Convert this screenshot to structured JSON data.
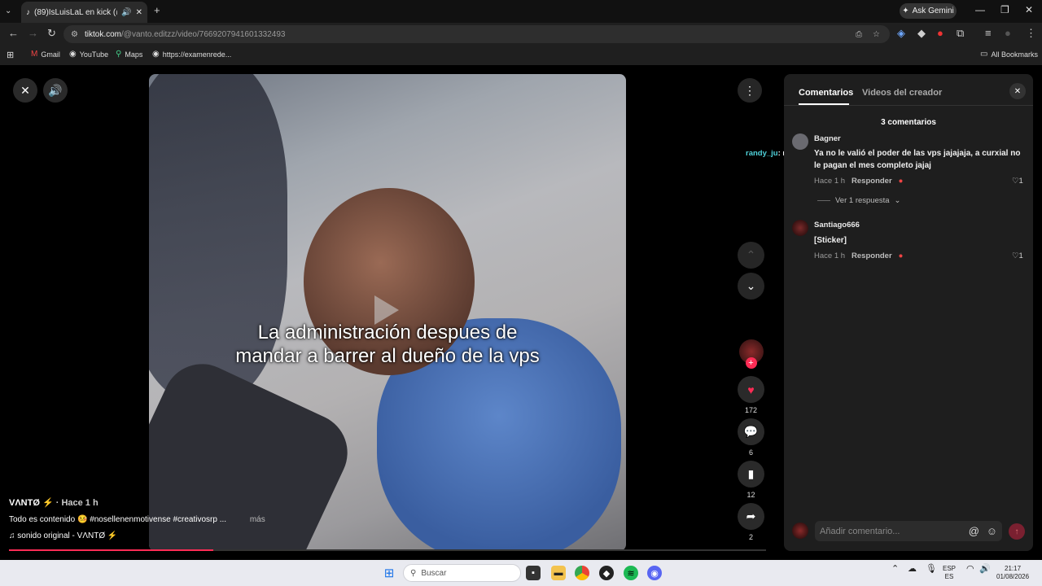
{
  "browser": {
    "tab_title": "(89)IsLuisLaL en kick",
    "tab_suffix": "(@",
    "ask_gemini": "Ask Gemini",
    "url_host": "tiktok.com",
    "url_path": "/@vanto.editzz/video/7669207941601332493",
    "bookmarks": [
      "Gmail",
      "YouTube",
      "Maps",
      "https://examenrede..."
    ],
    "all_bookmarks": "All Bookmarks"
  },
  "video": {
    "caption_line1": "La administración despues de",
    "caption_line2": "mandar a barrer al dueño de la vps",
    "author": "VΛNTØ",
    "time": "· Hace 1 h",
    "description": "Todo es contenido",
    "hashtags": "#nosellenenmotivense #creativosrp ...",
    "more": "más",
    "sound": "sonido original - VΛNTØ",
    "likes": "172",
    "comments": "6",
    "saves": "12",
    "shares": "2",
    "overlay_comment_user": "randy_ju",
    "overlay_comment_text": ": no"
  },
  "panel": {
    "tab_comments": "Comentarios",
    "tab_creator": "Videos del creador",
    "count": "3 comentarios",
    "comments": [
      {
        "user": "Bagner",
        "text1": "Ya no le valió el poder de las vps jajajaja, a curxial no",
        "text2": "le pagan el mes completo jajaj",
        "time": "Hace 1 h",
        "reply": "Responder",
        "likes": "1",
        "view_replies": "Ver 1 respuesta"
      },
      {
        "user": "Santiago666",
        "text1": "[Sticker]",
        "time": "Hace 1 h",
        "reply": "Responder",
        "likes": "1"
      }
    ],
    "input_placeholder": "Añadir comentario..."
  },
  "taskbar": {
    "search": "Buscar",
    "lang1": "ESP",
    "lang2": "ES",
    "time": "21:17",
    "date": "01/08/2026"
  },
  "colors": {
    "accent": "#fe2c55",
    "chat_user": "#4fd1d9"
  }
}
